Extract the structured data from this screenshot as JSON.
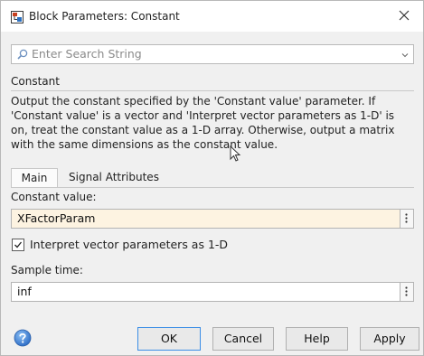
{
  "window": {
    "title": "Block Parameters: Constant",
    "close_glyph": "✕",
    "app_icon": "simulink-block-icon"
  },
  "search": {
    "placeholder": "Enter Search String",
    "icon": "search-icon",
    "dropdown_icon": "chevron-down-icon"
  },
  "block": {
    "name": "Constant",
    "description": "Output the constant specified by the 'Constant value' parameter. If 'Constant value' is a vector and 'Interpret vector parameters as 1-D' is on, treat the constant value as a 1-D array. Otherwise, output a matrix with the same dimensions as the constant value."
  },
  "tabs": [
    {
      "label": "Main",
      "selected": true
    },
    {
      "label": "Signal Attributes",
      "selected": false
    }
  ],
  "parameters": {
    "constant_value_label": "Constant value:",
    "constant_value": "XFactorParam",
    "constant_value_bg": "#fdf3e1",
    "interpret_label": "Interpret vector parameters as 1-D",
    "interpret_checked": true,
    "sample_time_label": "Sample time:",
    "sample_time": "inf"
  },
  "buttons": {
    "ok": "OK",
    "cancel": "Cancel",
    "help": "Help",
    "apply": "Apply"
  },
  "colors": {
    "ok_border": "#3b8ee6",
    "help_icon": "#2f6fc7"
  }
}
